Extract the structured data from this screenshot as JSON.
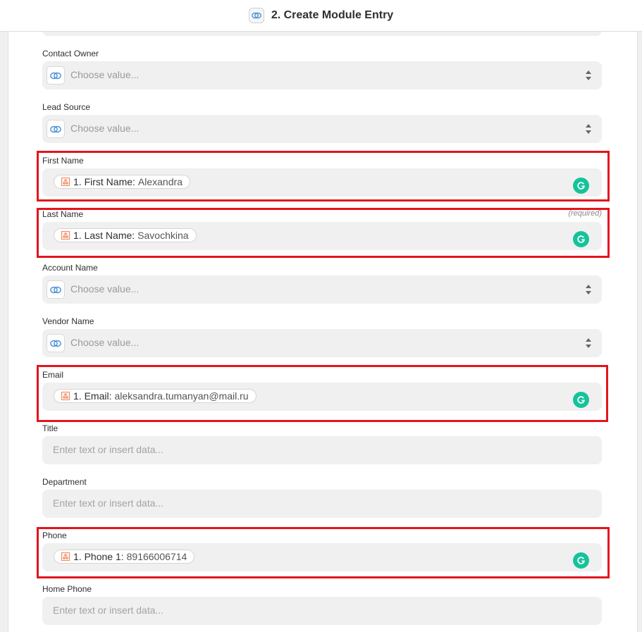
{
  "header": {
    "title": "2. Create Module Entry",
    "app_icon": "zoho-crm-icon"
  },
  "fields": {
    "contact_owner": {
      "label": "Contact Owner",
      "placeholder": "Choose value..."
    },
    "lead_source": {
      "label": "Lead Source",
      "placeholder": "Choose value..."
    },
    "first_name": {
      "label": "First Name",
      "step": "1. First Name:",
      "value": "Alexandra"
    },
    "last_name": {
      "label": "Last Name",
      "required": "(required)",
      "step": "1. Last Name:",
      "value": "Savochkina"
    },
    "account_name": {
      "label": "Account Name",
      "placeholder": "Choose value..."
    },
    "vendor_name": {
      "label": "Vendor Name",
      "placeholder": "Choose value..."
    },
    "email": {
      "label": "Email",
      "step": "1. Email:",
      "value": "aleksandra.tumanyan@mail.ru"
    },
    "title": {
      "label": "Title",
      "placeholder": "Enter text or insert data..."
    },
    "department": {
      "label": "Department",
      "placeholder": "Enter text or insert data..."
    },
    "phone": {
      "label": "Phone",
      "step": "1. Phone 1:",
      "value": "89166006714"
    },
    "home_phone": {
      "label": "Home Phone",
      "placeholder": "Enter text or insert data..."
    }
  },
  "colors": {
    "highlight": "#e3151e",
    "grammarly": "#15c39a",
    "field_bg": "#f0f0f0"
  }
}
